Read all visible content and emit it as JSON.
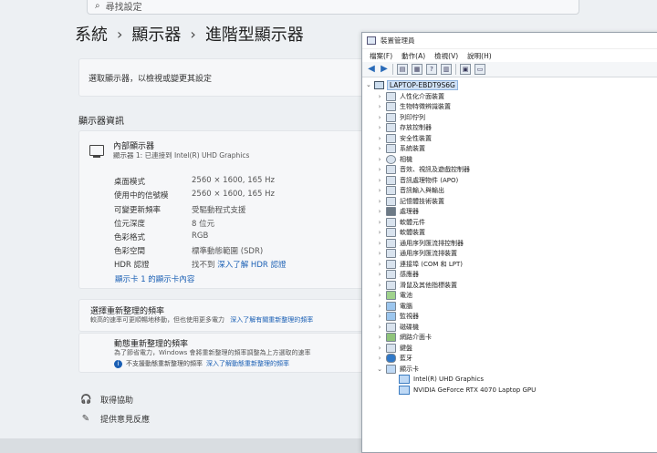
{
  "settings": {
    "search_placeholder": "尋找設定",
    "breadcrumb": [
      "系統",
      "顯示器",
      "進階型顯示器"
    ],
    "select_display_text": "選取顯示器，以檢視或變更其設定",
    "section_title": "顯示器資訊",
    "display": {
      "name": "內部顯示器",
      "subtitle": "顯示器 1: 已連接到 Intel(R) UHD Graphics",
      "rows": [
        {
          "label": "桌面模式",
          "value": "2560 × 1600, 165 Hz"
        },
        {
          "label": "使用中的信號模",
          "value": "2560 × 1600, 165 Hz"
        },
        {
          "label": "可變更新頻率",
          "value": "受驅動程式支援"
        },
        {
          "label": "位元深度",
          "value": "8 位元"
        },
        {
          "label": "色彩格式",
          "value": "RGB"
        },
        {
          "label": "色彩空間",
          "value": "標準動態範圍 (SDR)"
        },
        {
          "label": "HDR 認證",
          "value": "找不到",
          "link": "深入了解 HDR 認證"
        }
      ],
      "adapter_link": "顯示卡 1 的顯示卡內容"
    },
    "refresh": {
      "title": "選擇重新整理的頻率",
      "desc": "較高的速率可更順暢地移動，但也使用更多電力",
      "link": "深入了解有關重新整理的頻率"
    },
    "dynamic_refresh": {
      "title": "動態重新整理的頻率",
      "desc": "為了節省電力，Windows 會將重新整理的頻率調整為上方選取的速率",
      "note": "不支援動態重新整理的頻率",
      "note_link": "深入了解動態重新整理的頻率"
    },
    "help": "取得協助",
    "feedback": "提供意見反應"
  },
  "device_manager": {
    "title": "裝置管理員",
    "menu": [
      "檔案(F)",
      "動作(A)",
      "檢視(V)",
      "說明(H)"
    ],
    "root": "LAPTOP-EBDT9S6G",
    "categories": [
      "人性化介面裝置",
      "生物特徵辨識裝置",
      "列印佇列",
      "存放控制器",
      "安全性裝置",
      "系統裝置",
      "相機",
      "音效、視訊及遊戲控制器",
      "音訊處理物件 (APO)",
      "音訊輸入與輸出",
      "記憶體技術裝置",
      "處理器",
      "軟體元件",
      "軟體裝置",
      "通用序列匯流排控制器",
      "通用序列匯流排裝置",
      "連接埠 (COM 和 LPT)",
      "感應器",
      "滑鼠及其他指標裝置",
      "電池",
      "電腦",
      "監視器",
      "磁碟機",
      "網路介面卡",
      "鍵盤",
      "藍牙",
      "顯示卡"
    ],
    "display_adapters": [
      "Intel(R) UHD Graphics",
      "NVIDIA GeForce RTX 4070 Laptop GPU"
    ]
  },
  "colors": {
    "accent": "#1a5fb4",
    "selection": "#cfe1f6"
  }
}
